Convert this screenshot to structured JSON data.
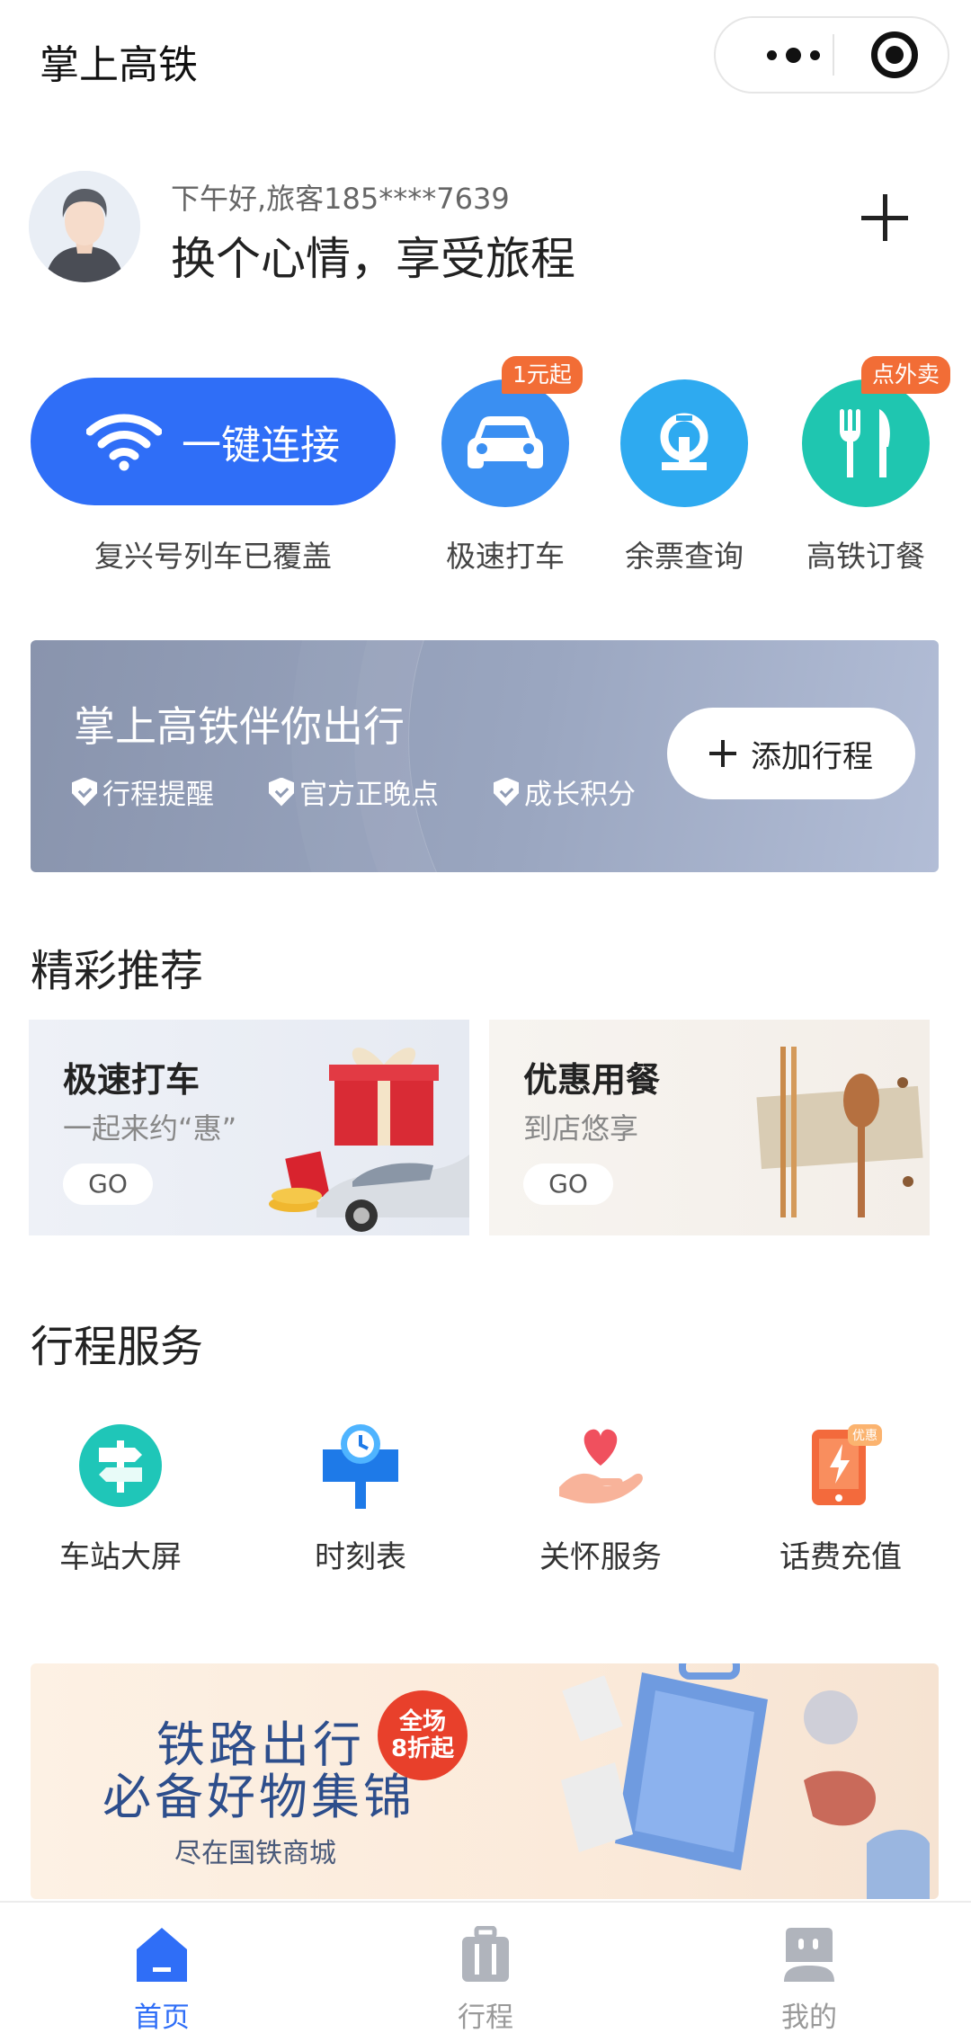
{
  "header": {
    "title": "掌上高铁",
    "more_icon": "more-dots-icon",
    "close_icon": "target-circle-icon"
  },
  "user": {
    "greeting": "下午好,旅客185****7639",
    "slogan": "换个心情，享受旅程",
    "add_icon": "plus-icon"
  },
  "quick_actions": {
    "wifi": {
      "label": "一键连接",
      "caption": "复兴号列车已覆盖",
      "icon": "wifi-icon",
      "color": "#2f6ef7"
    },
    "items": [
      {
        "label": "极速打车",
        "badge": "1元起",
        "icon": "car-icon",
        "color": "#3a8ff2"
      },
      {
        "label": "余票查询",
        "badge": "",
        "icon": "railway-logo-icon",
        "color": "#2eaaf0"
      },
      {
        "label": "高铁订餐",
        "badge": "点外卖",
        "icon": "fork-knife-icon",
        "color": "#1fc6b0"
      }
    ],
    "badge_color": "#f26d36"
  },
  "trip_banner": {
    "title": "掌上高铁伴你出行",
    "features": [
      "行程提醒",
      "官方正晚点",
      "成长积分"
    ],
    "button_label": "添加行程"
  },
  "recommend": {
    "title": "精彩推荐",
    "cards": [
      {
        "title": "极速打车",
        "subtitle": "一起来约“惠”",
        "go": "GO"
      },
      {
        "title": "优惠用餐",
        "subtitle": "到店悠享",
        "go": "GO"
      }
    ]
  },
  "services": {
    "title": "行程服务",
    "items": [
      {
        "label": "车站大屏",
        "icon": "signpost-icon"
      },
      {
        "label": "时刻表",
        "icon": "clock-sign-icon"
      },
      {
        "label": "关怀服务",
        "icon": "heart-hand-icon"
      },
      {
        "label": "话费充值",
        "icon": "phone-charge-icon"
      }
    ],
    "charge_badge": "优惠"
  },
  "mall_banner": {
    "line1": "铁路出行",
    "line2": "必备好物集锦",
    "line3": "尽在国铁商城",
    "badge_line1": "全场",
    "badge_line2": "8折起"
  },
  "tabbar": {
    "items": [
      {
        "label": "首页",
        "icon": "home-icon",
        "active": true
      },
      {
        "label": "行程",
        "icon": "luggage-icon",
        "active": false
      },
      {
        "label": "我的",
        "icon": "profile-icon",
        "active": false
      }
    ],
    "active_color": "#2f6ef7"
  }
}
